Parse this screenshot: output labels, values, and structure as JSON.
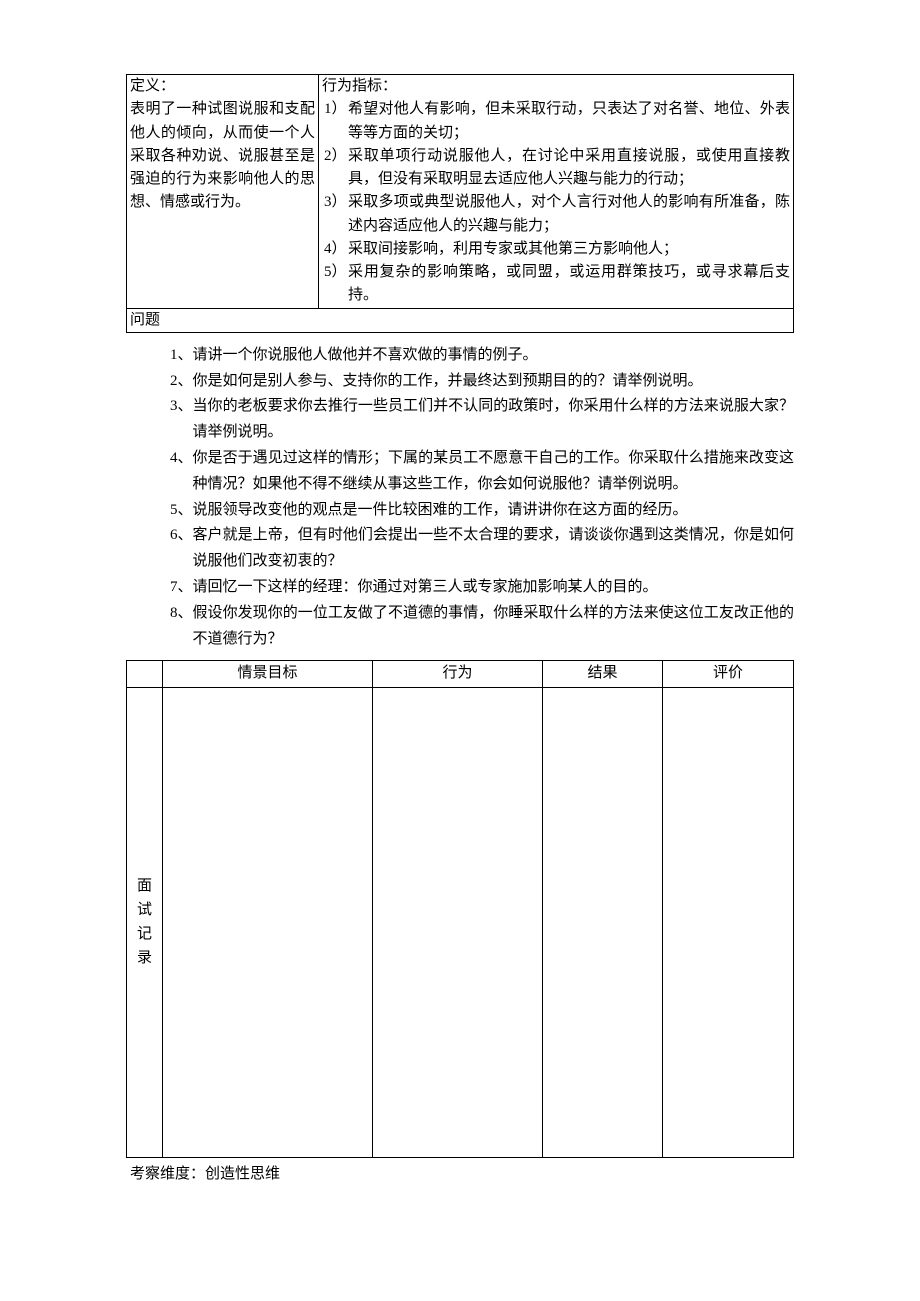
{
  "definition": {
    "label": "定义：",
    "text": "表明了一种试图说服和支配他人的倾向，从而使一个人采取各种劝说、说服甚至是强迫的行为来影响他人的思想、情感或行为。"
  },
  "indicators": {
    "label": "行为指标：",
    "items": [
      {
        "num": "1）",
        "text": "希望对他人有影响，但未采取行动，只表达了对名誉、地位、外表等等方面的关切；"
      },
      {
        "num": "2）",
        "text": "采取单项行动说服他人，在讨论中采用直接说服，或使用直接教具，但没有采取明显去适应他人兴趣与能力的行动；"
      },
      {
        "num": "3）",
        "text": "采取多项或典型说服他人，对个人言行对他人的影响有所准备，陈述内容适应他人的兴趣与能力；"
      },
      {
        "num": "4）",
        "text": "采取间接影响，利用专家或其他第三方影响他人；"
      },
      {
        "num": "5）",
        "text": "采用复杂的影响策略，或同盟，或运用群策技巧，或寻求幕后支持。"
      }
    ]
  },
  "questions_label": "问题",
  "questions": [
    {
      "num": "1、",
      "text": "请讲一个你说服他人做他并不喜欢做的事情的例子。"
    },
    {
      "num": "2、",
      "text": "你是如何是别人参与、支持你的工作，并最终达到预期目的的？请举例说明。"
    },
    {
      "num": "3、",
      "text": "当你的老板要求你去推行一些员工们并不认同的政策时，你采用什么样的方法来说服大家？请举例说明。"
    },
    {
      "num": "4、",
      "text": "你是否于遇见过这样的情形；下属的某员工不愿意干自己的工作。你采取什么措施来改变这种情况？如果他不得不继续从事这些工作，你会如何说服他？请举例说明。"
    },
    {
      "num": "5、",
      "text": "说服领导改变他的观点是一件比较困难的工作，请讲讲你在这方面的经历。"
    },
    {
      "num": "6、",
      "text": "客户就是上帝，但有时他们会提出一些不太合理的要求，请谈谈你遇到这类情况，你是如何说服他们改变初衷的？"
    },
    {
      "num": "7、",
      "text": "请回忆一下这样的经理：你通过对第三人或专家施加影响某人的目的。"
    },
    {
      "num": "8、",
      "text": "假设你发现你的一位工友做了不道德的事情，你睡采取什么样的方法来使这位工友改正他的不道德行为？"
    }
  ],
  "grid": {
    "row_label_1": "面试",
    "row_label_2": "记录",
    "headers": [
      "情景目标",
      "行为",
      "结果",
      "评价"
    ]
  },
  "footer": "考察维度：创造性思维"
}
